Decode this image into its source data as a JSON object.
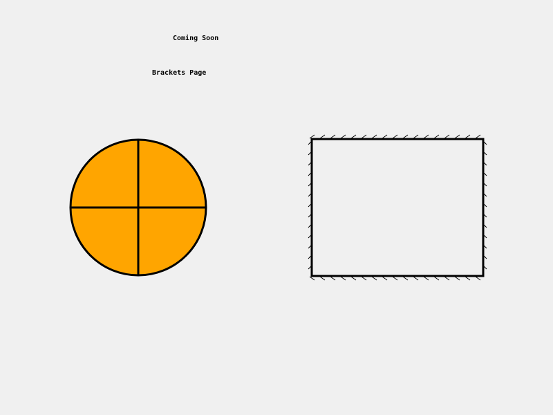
{
  "page": {
    "background": "#f0f0f0",
    "banner_text": "Coming Soon",
    "title": "Brackets Page"
  },
  "shapes": {
    "ball": {
      "fill": "#ffa500",
      "stroke": "#000000"
    },
    "frame": {
      "fill": "#f0f0f0",
      "stroke": "#000000",
      "hatch_style": "diagonal-ticks"
    }
  }
}
